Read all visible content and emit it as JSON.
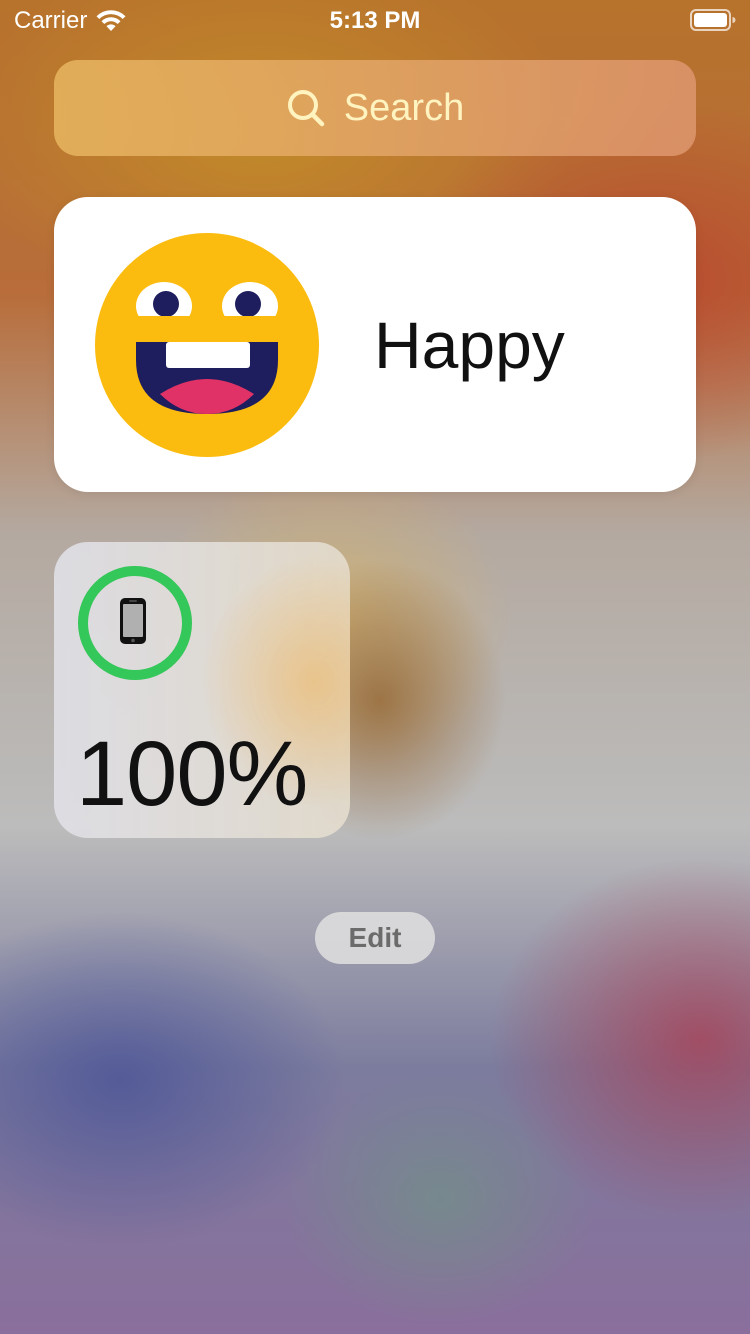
{
  "status_bar": {
    "carrier": "Carrier",
    "time": "5:13 PM",
    "wifi_icon": "wifi-icon",
    "battery_icon": "battery-icon"
  },
  "search": {
    "placeholder": "Search",
    "icon": "search-icon"
  },
  "mood_widget": {
    "emoji": "grinning-face",
    "label": "Happy"
  },
  "battery_widget": {
    "device_icon": "iphone-icon",
    "percent_text": "100%",
    "level": 1.0,
    "ring_color": "#34c759"
  },
  "edit_button": {
    "label": "Edit"
  },
  "colors": {
    "accent_green": "#34c759",
    "emoji_yellow": "#fbbc0f",
    "emoji_mouth": "#1e1d5e",
    "emoji_tongue": "#e03266"
  }
}
